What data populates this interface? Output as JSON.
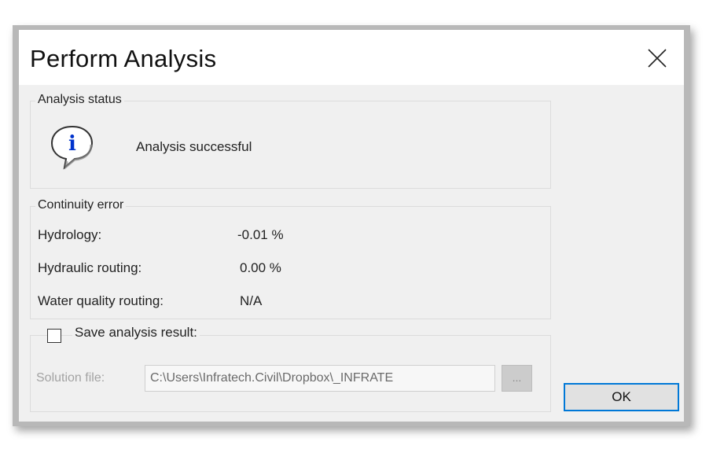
{
  "dialog": {
    "title": "Perform Analysis",
    "close_icon": "close-icon"
  },
  "analysis_status": {
    "label": "Analysis status",
    "icon": "info-icon",
    "message": "Analysis successful"
  },
  "continuity_error": {
    "label": "Continuity error",
    "rows": [
      {
        "name": "Hydrology:",
        "value": "-0.01 %"
      },
      {
        "name": "Hydraulic routing:",
        "value": "0.00 %"
      },
      {
        "name": "Water quality routing:",
        "value": "N/A"
      }
    ]
  },
  "save_result": {
    "label": "Save analysis result:",
    "checked": false,
    "solution_label": "Solution file:",
    "solution_value": "C:\\Users\\Infratech.Civil\\Dropbox\\_INFRATE",
    "browse_label": "..."
  },
  "buttons": {
    "ok_label": "OK"
  },
  "colors": {
    "focus_border": "#0078d7",
    "info_blue": "#0033cc"
  }
}
